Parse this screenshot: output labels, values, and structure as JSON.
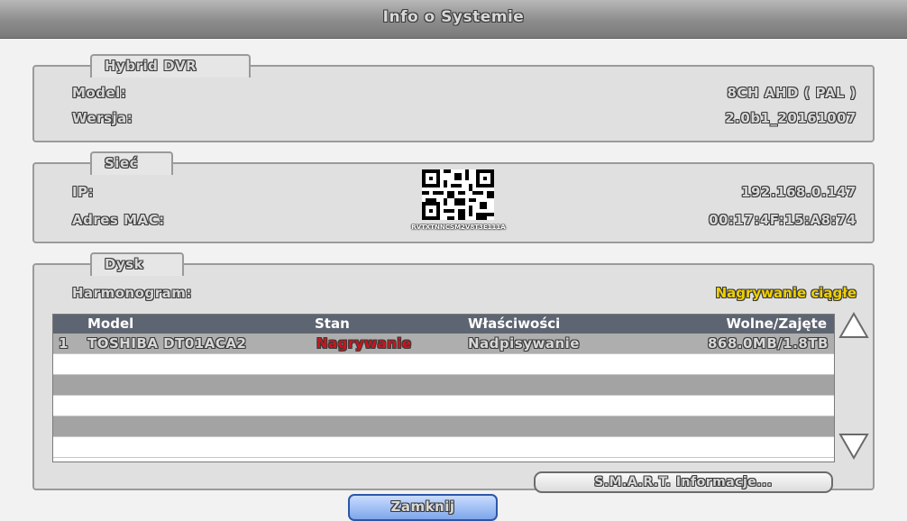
{
  "window": {
    "title": "Info o Systemie"
  },
  "hybrid": {
    "tab": "Hybrid DVR",
    "model_label": "Model:",
    "model_value": "8CH AHD ( PAL )",
    "version_label": "Wersja:",
    "version_value": "2.0b1_20161007"
  },
  "network": {
    "tab": "Sieć",
    "ip_label": "IP:",
    "ip_value": "192.168.0.147",
    "mac_label": "Adres MAC:",
    "mac_value": "00:17:4F:15:A8:74",
    "qr_caption": "RVTXTNNCSM2V8T3E111A"
  },
  "disk": {
    "tab": "Dysk",
    "schedule_label": "Harmonogram:",
    "schedule_value": "Nagrywanie ciągłe",
    "columns": [
      "Model",
      "Stan",
      "Właściwości",
      "Wolne/Zajęte"
    ],
    "rows": [
      {
        "index": "1",
        "model": "TOSHIBA DT01ACA2",
        "status": "Nagrywanie",
        "property": "Nadpisywanie",
        "space": "868.0MB/1.8TB"
      }
    ],
    "smart_button": "S.M.A.R.T. Informacje..."
  },
  "footer": {
    "close_button": "Zamknij"
  },
  "colors": {
    "status_recording": "#c8161d",
    "schedule_value": "#f0d000",
    "header_bg": "#5e6572"
  }
}
